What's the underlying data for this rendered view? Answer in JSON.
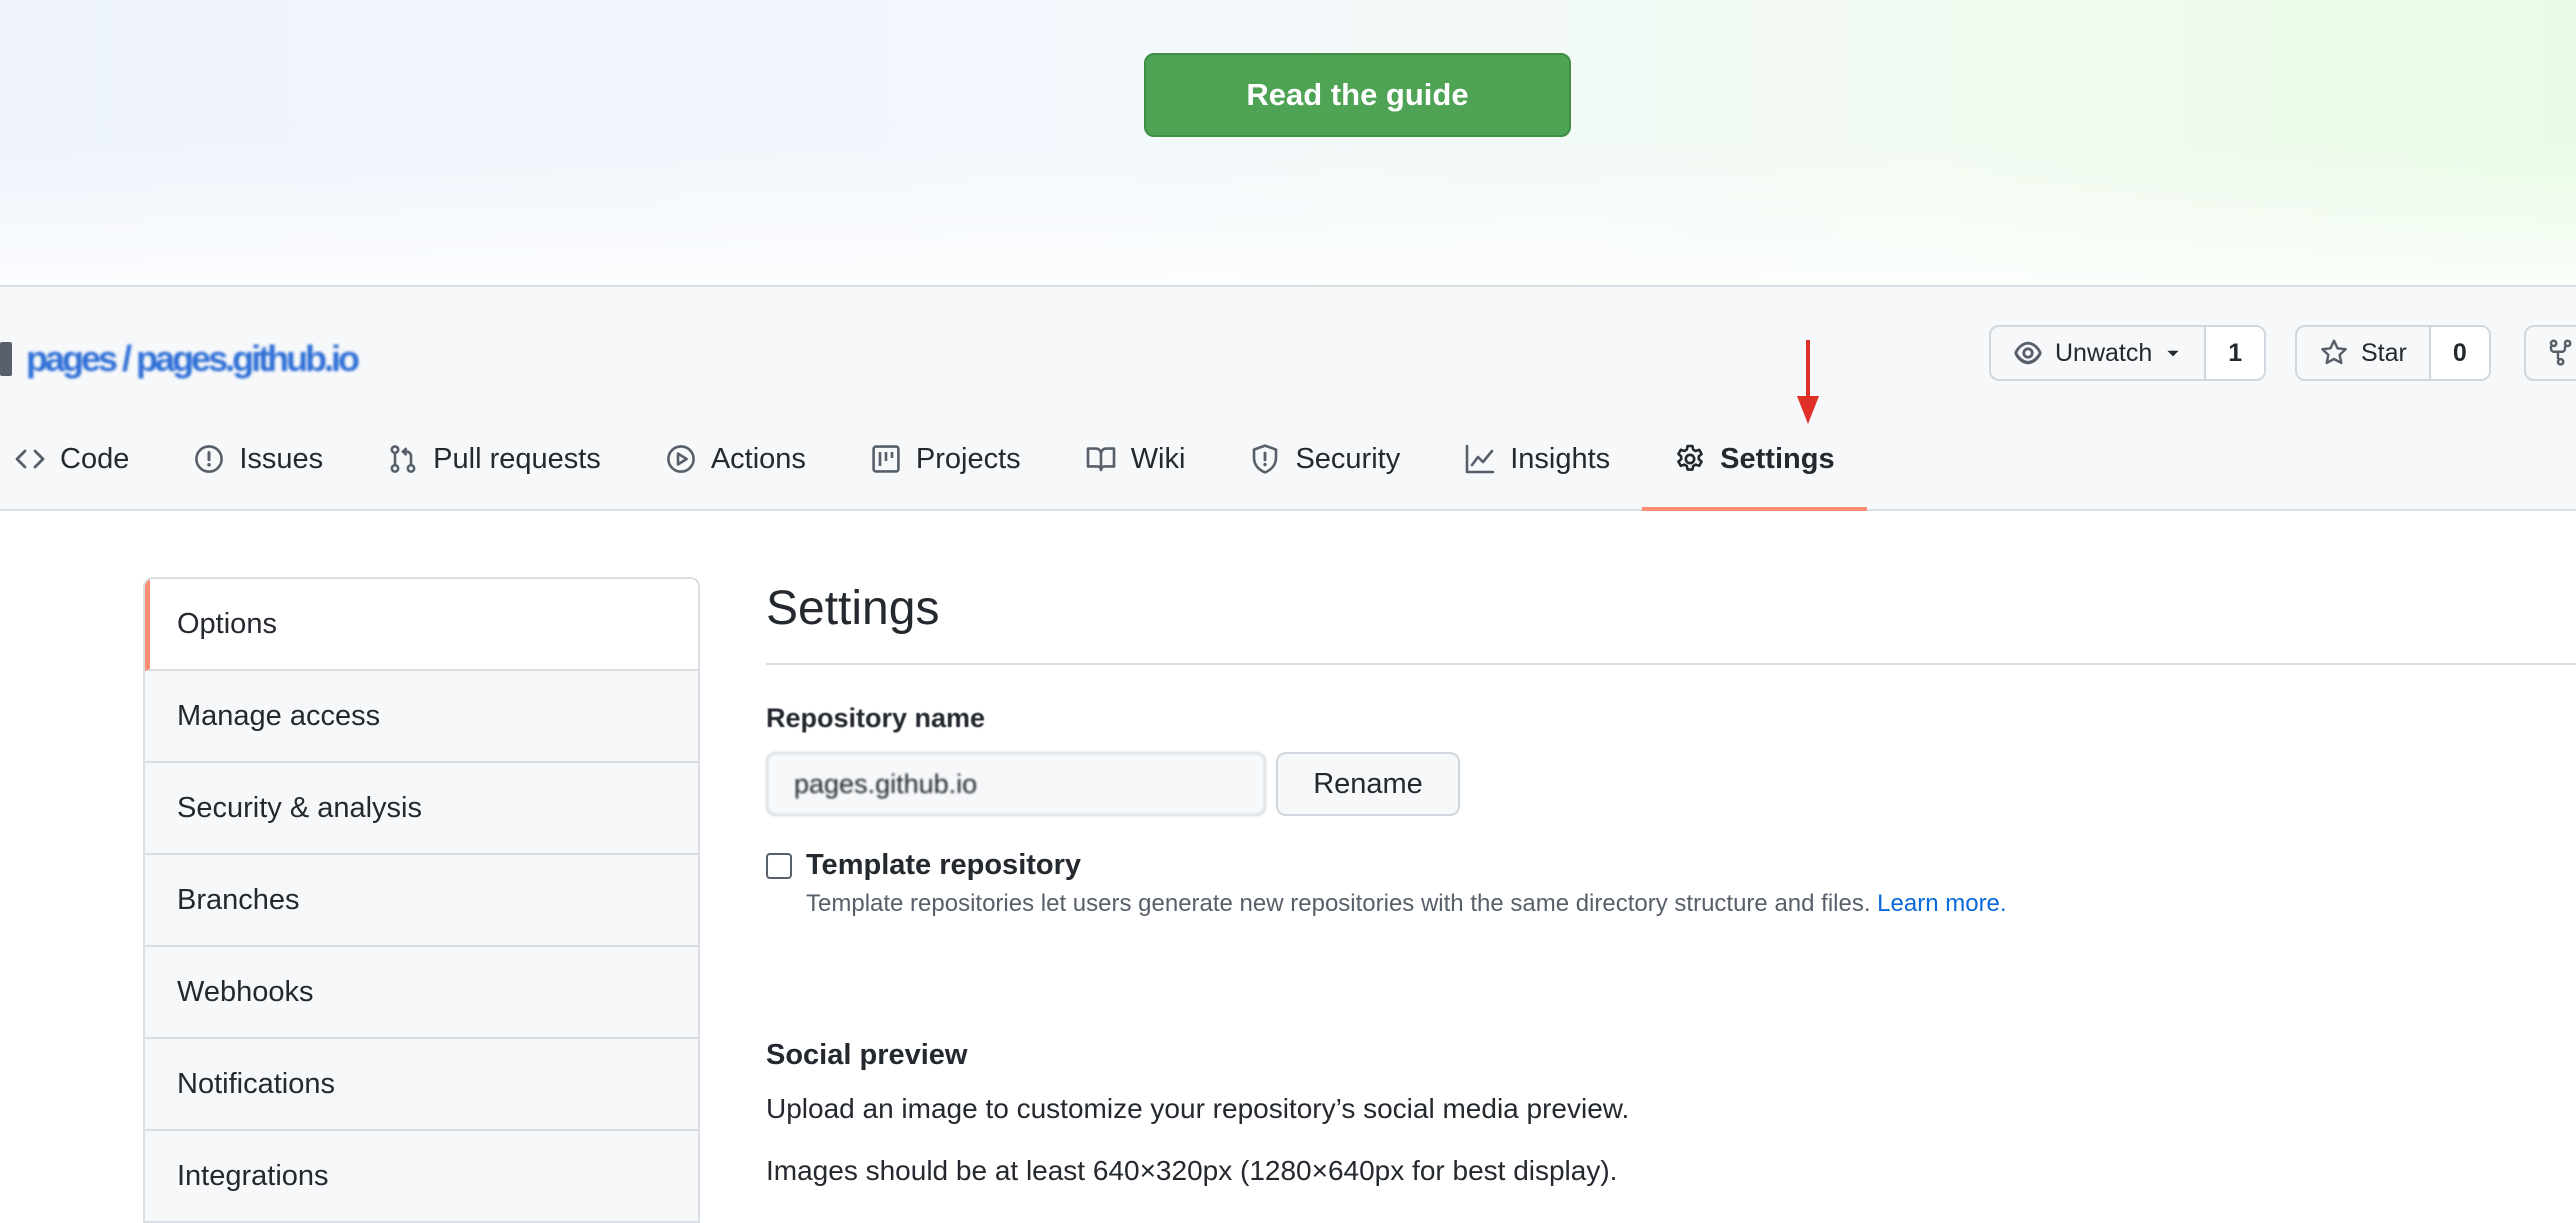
{
  "hero": {
    "guide_button": "Read the guide"
  },
  "repo": {
    "name": "pages / pages.github.io",
    "watch": {
      "label": "Unwatch",
      "count": "1"
    },
    "star": {
      "label": "Star",
      "count": "0"
    }
  },
  "tabs": [
    {
      "label": "Code",
      "icon": "code-icon"
    },
    {
      "label": "Issues",
      "icon": "issue-icon"
    },
    {
      "label": "Pull requests",
      "icon": "pull-request-icon"
    },
    {
      "label": "Actions",
      "icon": "play-icon"
    },
    {
      "label": "Projects",
      "icon": "project-icon"
    },
    {
      "label": "Wiki",
      "icon": "book-icon"
    },
    {
      "label": "Security",
      "icon": "shield-icon"
    },
    {
      "label": "Insights",
      "icon": "graph-icon"
    },
    {
      "label": "Settings",
      "icon": "gear-icon",
      "active": true
    }
  ],
  "sidebar": {
    "items": [
      {
        "label": "Options",
        "selected": true
      },
      {
        "label": "Manage access"
      },
      {
        "label": "Security & analysis"
      },
      {
        "label": "Branches"
      },
      {
        "label": "Webhooks"
      },
      {
        "label": "Notifications"
      },
      {
        "label": "Integrations"
      }
    ]
  },
  "settings": {
    "title": "Settings",
    "repo_name_label": "Repository name",
    "repo_name_value": "pages.github.io",
    "rename_button": "Rename",
    "template_label": "Template repository",
    "template_desc": "Template repositories let users generate new repositories with the same directory structure and files.",
    "learn_more": "Learn more.",
    "social_title": "Social preview",
    "social_text1": "Upload an image to customize your repository’s social media preview.",
    "social_text2": "Images should be at least 640×320px (1280×640px for best display)."
  },
  "colors": {
    "accent": "#fd8c73",
    "guide_button": "#4fa355",
    "link": "#0969da",
    "annotation_arrow": "#e0302a"
  }
}
